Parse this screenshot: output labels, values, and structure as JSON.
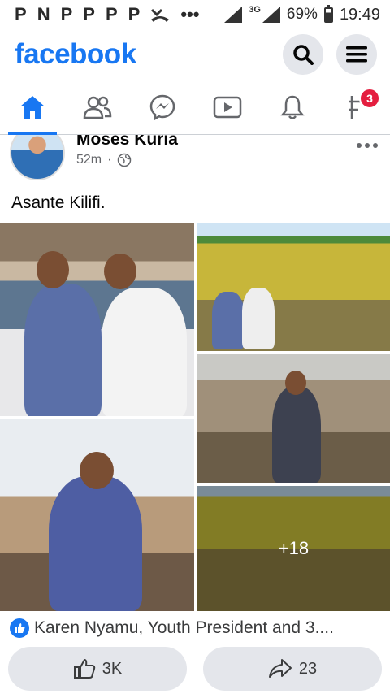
{
  "status_bar": {
    "left_icons": [
      "P",
      "N",
      "P",
      "P",
      "P",
      "P"
    ],
    "network_type": "3G",
    "battery": "69%",
    "time": "19:49"
  },
  "header": {
    "logo": "facebook"
  },
  "nav": {
    "notifications_badge": "3"
  },
  "post": {
    "author": "Moses Kuria",
    "time": "52m",
    "separator": "·",
    "text": "Asante Kilifi.",
    "more_photos": "+18",
    "reactions_text": "Karen Nyamu, Youth President and 3....",
    "like_count": "3K",
    "share_count": "23"
  },
  "colors": {
    "brand": "#1877f2",
    "badge": "#e41e3f"
  }
}
